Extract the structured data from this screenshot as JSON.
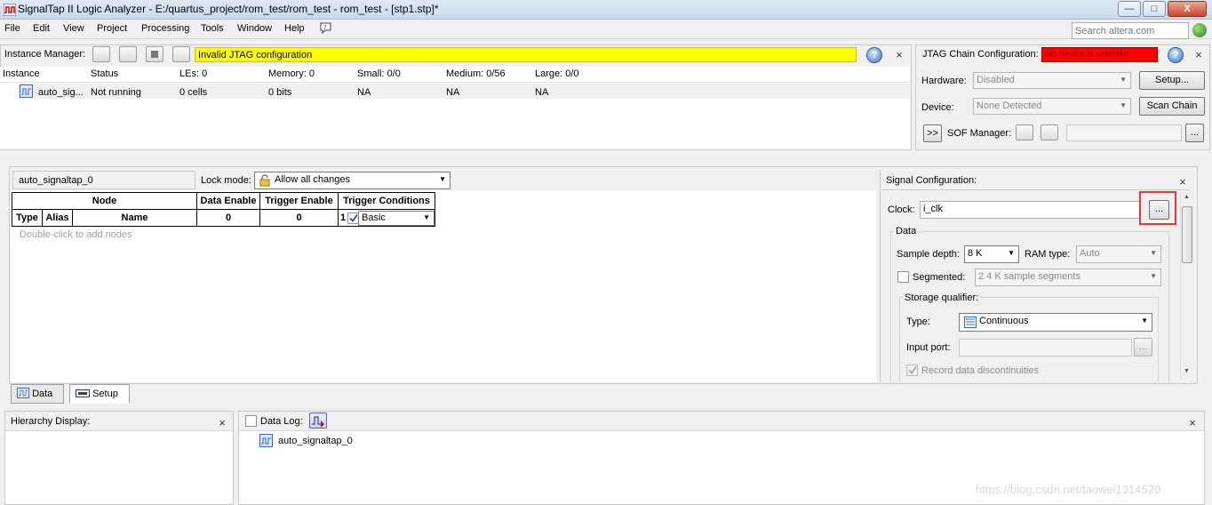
{
  "window": {
    "title": "SignalTap II Logic Analyzer - E:/quartus_project/rom_test/rom_test - rom_test - [stp1.stp]*",
    "buttons": {
      "minimize": "—",
      "maximize": "□",
      "close": "X"
    }
  },
  "menu": [
    "File",
    "Edit",
    "View",
    "Project",
    "Processing",
    "Tools",
    "Window",
    "Help"
  ],
  "search": {
    "placeholder": "Search altera.com"
  },
  "instance_manager": {
    "label": "Instance Manager:",
    "status_message": "Invalid JTAG configuration",
    "columns": [
      "Instance",
      "Status",
      "LEs: 0",
      "Memory: 0",
      "Small: 0/0",
      "Medium: 0/56",
      "Large: 0/0"
    ],
    "rows": [
      [
        "auto_sig...",
        "Not running",
        "0 cells",
        "0 bits",
        "NA",
        "NA",
        "NA"
      ]
    ]
  },
  "jtag": {
    "label": "JTAG Chain Configuration:",
    "status_message": "No device is selected",
    "hardware_label": "Hardware:",
    "hardware_value": "Disabled",
    "setup_button": "Setup...",
    "device_label": "Device:",
    "device_value": "None Detected",
    "scan_chain_button": "Scan Chain",
    "expand_button": ">>",
    "sof_label": "SOF Manager:",
    "sof_browse": "..."
  },
  "node_list": {
    "instance_name": "auto_signaltap_0",
    "lock_mode_label": "Lock mode:",
    "lock_mode_value": "Allow all changes",
    "header_row1": {
      "node": "Node",
      "data_enable": "Data Enable",
      "trigger_enable": "Trigger Enable",
      "trigger_conditions": "Trigger Conditions"
    },
    "header_row2": {
      "type": "Type",
      "alias": "Alias",
      "name": "Name",
      "data_enable": "0",
      "trigger_enable": "0",
      "trigger_index": "1",
      "trigger_value": "Basic"
    },
    "hint": "Double-click to add nodes"
  },
  "signal_config": {
    "label": "Signal Configuration:",
    "clock_label": "Clock:",
    "clock_value": "i_clk",
    "clock_browse": "...",
    "data_group": "Data",
    "sample_depth_label": "Sample depth:",
    "sample_depth_value": "8 K",
    "ram_type_label": "RAM type:",
    "ram_type_value": "Auto",
    "segmented_label": "Segmented:",
    "segmented_value": "2  4 K sample segments",
    "storage_qualifier_group": "Storage qualifier:",
    "type_label": "Type:",
    "type_value": "Continuous",
    "input_port_label": "Input port:",
    "input_port_browse": "...",
    "record_label": "Record data discontinuities"
  },
  "bottom_tabs": [
    "Data",
    "Setup"
  ],
  "hierarchy": {
    "label": "Hierarchy Display:"
  },
  "data_log": {
    "label": "Data Log:",
    "item": "auto_signaltap_0"
  },
  "watermark": "https://blog.csdn.net/taowei1314520",
  "colors": {
    "warning": "#ffff00",
    "error": "#ff0000",
    "highlight": "#e53935"
  }
}
